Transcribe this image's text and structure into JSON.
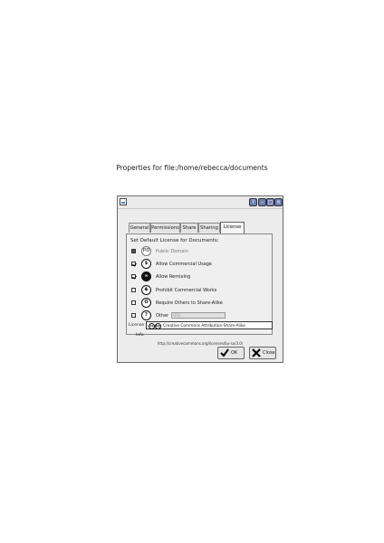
{
  "caption": "Properties for file:/home/rebecca/documents",
  "titlebar": {
    "help_label": "?",
    "minimize_label": "–",
    "maximize_label": "□",
    "close_label": "×"
  },
  "tabs": [
    {
      "label": "General",
      "active": false
    },
    {
      "label": "Permissions",
      "active": false
    },
    {
      "label": "Share",
      "active": false
    },
    {
      "label": "Sharing",
      "active": false
    },
    {
      "label": "License",
      "active": true
    }
  ],
  "panel": {
    "heading": "Set Default License for Documents:",
    "options": [
      {
        "icon": "PD",
        "label": "Public Domain",
        "checked": false,
        "enabled": false
      },
      {
        "icon": "$",
        "label": "Allow Commercial Usage",
        "checked": true,
        "enabled": true
      },
      {
        "icon": "∞",
        "label": "Allow Remixing",
        "checked": true,
        "enabled": true
      },
      {
        "icon": "$",
        "label": "Prohibit Commercial Works",
        "checked": false,
        "enabled": true
      },
      {
        "icon": "O",
        "label": "Require Others to Share-Alike",
        "checked": false,
        "enabled": true
      },
      {
        "icon": "?",
        "label": "Other",
        "checked": false,
        "enabled": true
      }
    ],
    "other_value": "URL"
  },
  "license": {
    "label": "License",
    "icons": [
      "cc",
      "by"
    ],
    "value": "Creative Commons Attribution-Share-Alike",
    "info": "Info",
    "url": "http://creativecommons.org/licenses/by-sa/3.0/"
  },
  "buttons": {
    "ok": "OK",
    "close": "Close"
  }
}
